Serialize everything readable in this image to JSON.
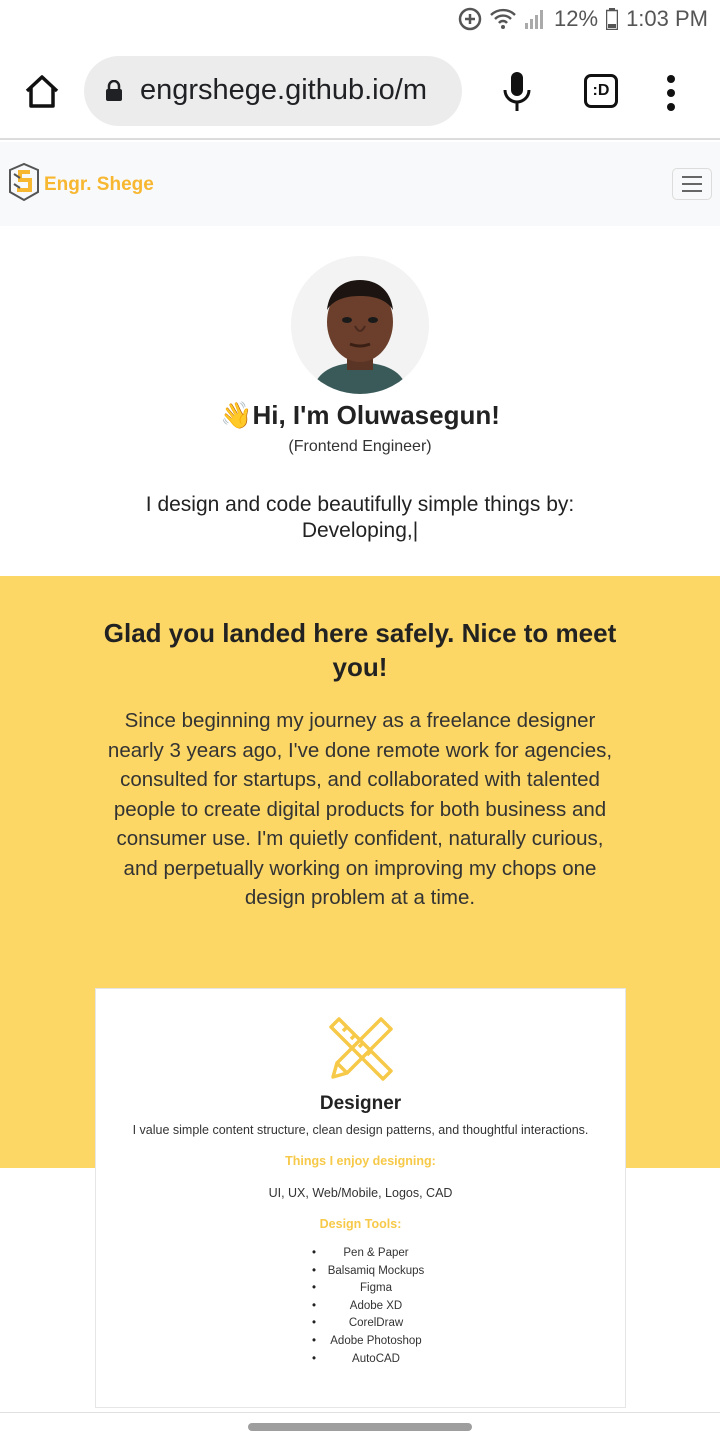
{
  "status_bar": {
    "battery": "12%",
    "time": "1:03 PM"
  },
  "browser": {
    "url": "engrshege.github.io/m",
    "tab_count": ":D"
  },
  "site": {
    "brand": "Engr. Shege"
  },
  "hero": {
    "wave": "👋",
    "title": "Hi, I'm Oluwasegun!",
    "subtitle": "(Frontend Engineer)",
    "description_line1": "I design and code beautifully simple things by:",
    "description_line2": "Developing,|"
  },
  "about": {
    "title": "Glad you landed here safely. Nice to meet you!",
    "text": "Since beginning my journey as a freelance designer nearly 3 years ago, I've done remote work for agencies, consulted for startups, and collaborated with talented people to create digital products for both business and consumer use. I'm quietly confident, naturally curious, and perpetually working on improving my chops one design problem at a time."
  },
  "card": {
    "icon": "pencil-ruler-icon",
    "title": "Designer",
    "text": "I value simple content structure, clean design patterns, and thoughtful interactions.",
    "enjoy_heading": "Things I enjoy designing:",
    "enjoy_list": "UI, UX, Web/Mobile, Logos, CAD",
    "tools_heading": "Design Tools:",
    "tools": [
      "Pen & Paper",
      "Balsamiq Mockups",
      "Figma",
      "Adobe XD",
      "CorelDraw",
      "Adobe Photoshop",
      "AutoCAD"
    ]
  },
  "colors": {
    "accent": "#fcd766",
    "brand": "#f7b731"
  }
}
